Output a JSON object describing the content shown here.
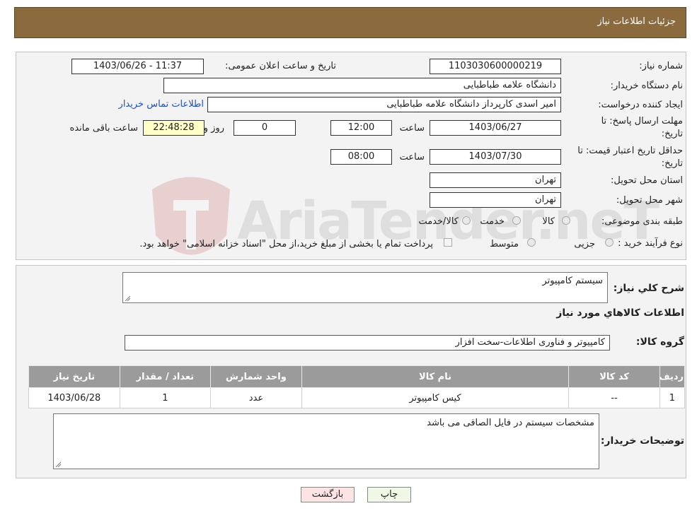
{
  "header": {
    "title": "جزئیات اطلاعات نیاز"
  },
  "watermark": {
    "text": "AriaTender.neT"
  },
  "form": {
    "need_number_label": "شماره نیاز:",
    "need_number": "1103030600000219",
    "announce_label": "تاریخ و ساعت اعلان عمومی:",
    "announce_value": "1403/06/26 - 11:37",
    "buyer_label": "نام دستگاه خریدار:",
    "buyer_value": "دانشگاه علامه طباطبایی",
    "creator_label": "ایجاد کننده درخواست:",
    "creator_value": "امیر اسدی کارپرداز دانشگاه علامه طباطبایی",
    "contact_link": "اطلاعات تماس خریدار",
    "deadline_label_1": "مهلت ارسال پاسخ: تا",
    "deadline_label_2": "تاریخ:",
    "deadline_date": "1403/06/27",
    "time_label": "ساعت",
    "deadline_time": "12:00",
    "days_value": "0",
    "days_label": "روز و",
    "remaining_value": "22:48:28",
    "remaining_label": "ساعت باقی مانده",
    "validity_label_1": "حداقل تاریخ اعتبار قیمت: تا",
    "validity_label_2": "تاریخ:",
    "validity_date": "1403/07/30",
    "validity_time": "08:00",
    "province_label": "استان محل تحویل:",
    "province_value": "تهران",
    "city_label": "شهر محل تحویل:",
    "city_value": "تهران",
    "category_label": "طبقه بندی موضوعی:",
    "category_options": [
      "کالا",
      "خدمت",
      "کالا/خدمت"
    ],
    "process_label": "نوع فرآیند خرید :",
    "process_options": [
      "جزیی",
      "متوسط"
    ],
    "payment_note": "پرداخت تمام یا بخشی از مبلغ خرید،از محل \"اسناد خزانه اسلامی\" خواهد بود."
  },
  "details": {
    "summary_label": "شرح کلي نياز:",
    "summary_value": "سیستم کامپیوتر",
    "goods_heading": "اطلاعات کالاهاي مورد نياز",
    "group_label": "گروه کالا:",
    "group_value": "کامپیوتر و فناوری اطلاعات-سخت افزار",
    "table": {
      "headers": [
        "رديف",
        "کد کالا",
        "نام کالا",
        "واحد شمارش",
        "تعداد / مقدار",
        "تاريخ نياز"
      ],
      "rows": [
        [
          "1",
          "--",
          "کیس کامپیوتر",
          "عدد",
          "1",
          "1403/06/28"
        ]
      ]
    },
    "buyer_notes_label": "توضیحات خریدار:",
    "buyer_notes_value": "مشخصات سیستم در فایل الصاقی می باشد"
  },
  "buttons": {
    "print": "چاپ",
    "back": "بازگشت"
  },
  "colors": {
    "header_bg": "#8b6a3e",
    "link": "#1d4fc4",
    "counter_bg": "#ffffc8",
    "back_button_bg": "#fde4e4",
    "print_button_bg": "#eef8e4"
  }
}
